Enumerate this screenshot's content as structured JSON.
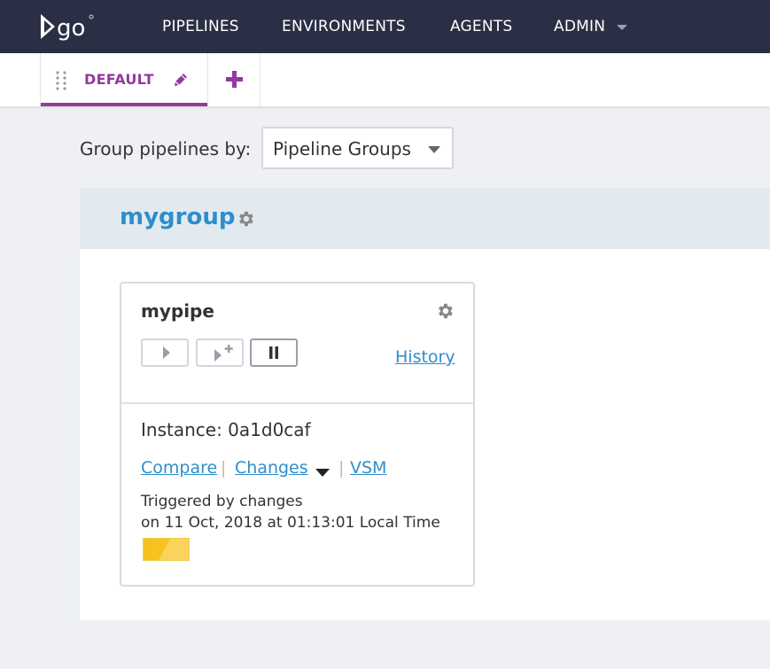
{
  "nav": {
    "logo_text": "go",
    "items": [
      {
        "label": "PIPELINES"
      },
      {
        "label": "ENVIRONMENTS"
      },
      {
        "label": "AGENTS"
      },
      {
        "label": "ADMIN"
      }
    ],
    "background": "#2b2f45"
  },
  "tabs": {
    "active_label": "DEFAULT",
    "accent": "#943a9e"
  },
  "grouping": {
    "label": "Group pipelines by:",
    "selected": "Pipeline Groups"
  },
  "group": {
    "name": "mygroup",
    "pipeline": {
      "name": "mypipe",
      "history_label": "History",
      "instance_label": "Instance: 0a1d0caf",
      "links": {
        "compare": "Compare",
        "changes": "Changes",
        "vsm": "VSM",
        "separator": "|"
      },
      "triggered_by": "Triggered by changes",
      "triggered_on": "on 11 Oct, 2018 at 01:13:01 Local Time",
      "stage_status_color": "#f5c518"
    }
  },
  "icons": {
    "logo": "go-logo-icon",
    "drag": "drag-handle-icon",
    "edit": "pencil-icon",
    "add": "plus-icon",
    "settings": "gear-icon",
    "trigger": "play-icon",
    "trigger_with_options": "play-with-options-icon",
    "pause": "pause-icon"
  },
  "colors": {
    "link": "#2e8ecc",
    "group_header_bg": "#e2eaf0"
  }
}
